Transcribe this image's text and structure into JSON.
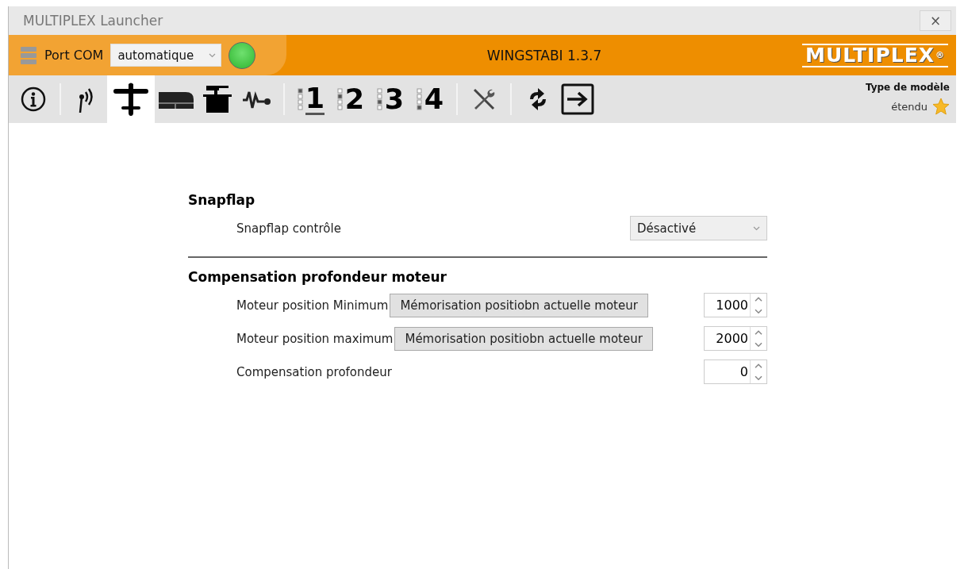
{
  "window": {
    "title": "MULTIPLEX Launcher",
    "close": "×"
  },
  "header": {
    "port_label": "Port COM",
    "port_value": "automatique",
    "connected": true,
    "device": "WINGSTABI 1.3.7",
    "logo": "MULTIPLEX",
    "logo_mark": "®"
  },
  "toolbar": [
    {
      "kind": "info",
      "selected": false
    },
    {
      "kind": "separator"
    },
    {
      "kind": "antenna",
      "selected": false
    },
    {
      "kind": "plane",
      "selected": true
    },
    {
      "kind": "wing",
      "selected": false
    },
    {
      "kind": "servo",
      "selected": false
    },
    {
      "kind": "wave",
      "selected": false
    },
    {
      "kind": "separator"
    },
    {
      "kind": "channel",
      "label": "1",
      "underlined": true,
      "selected": false
    },
    {
      "kind": "channel",
      "label": "2",
      "underlined": false,
      "selected": false
    },
    {
      "kind": "channel",
      "label": "3",
      "underlined": false,
      "selected": false
    },
    {
      "kind": "channel",
      "label": "4",
      "underlined": false,
      "selected": false
    },
    {
      "kind": "separator"
    },
    {
      "kind": "tools",
      "selected": false
    },
    {
      "kind": "separator"
    },
    {
      "kind": "refresh",
      "selected": false
    },
    {
      "kind": "exit",
      "selected": false
    }
  ],
  "model_type": {
    "label": "Type de modèle",
    "value": "étendu"
  },
  "sections": [
    {
      "title": "Snapflap",
      "rows": [
        {
          "kind": "dropdown",
          "label": "Snapflap contrôle",
          "value": "Désactivé"
        }
      ]
    },
    {
      "title": "Compensation profondeur moteur",
      "rows": [
        {
          "kind": "spinner",
          "label": "Moteur position Minimum",
          "button": "Mémorisation positiobn actuelle moteur",
          "value": "1000"
        },
        {
          "kind": "spinner",
          "label": "Moteur position maximum",
          "button": "Mémorisation positiobn actuelle moteur",
          "value": "2000"
        },
        {
          "kind": "spinner",
          "label": "Compensation profondeur",
          "value": "0"
        }
      ]
    }
  ]
}
